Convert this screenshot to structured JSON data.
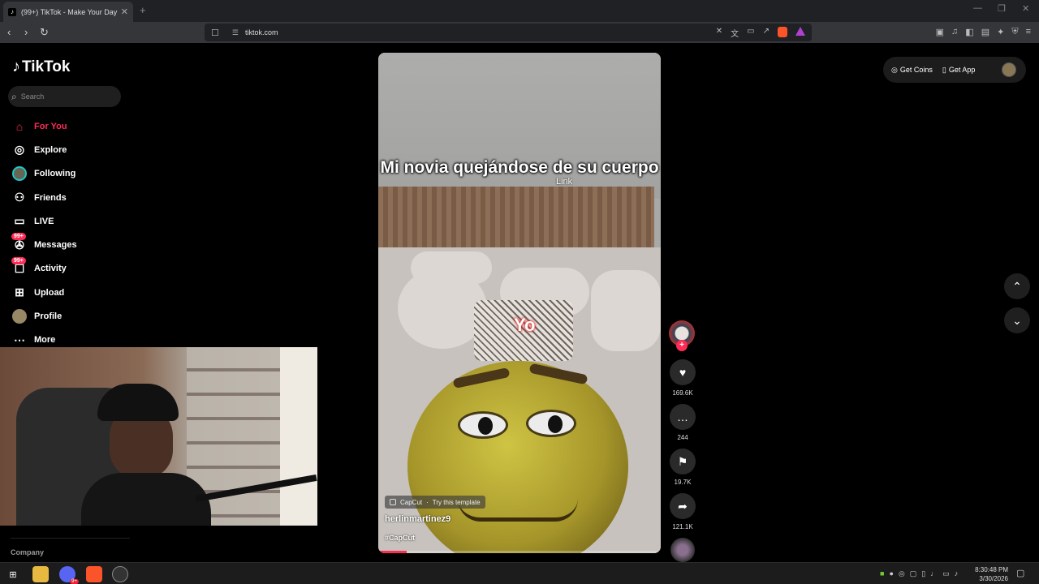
{
  "browser": {
    "tab_title": "(99+) TikTok - Make Your Day",
    "tab_favicon": "tiktok-note-icon",
    "new_tab": "+",
    "url": "tiktok.com",
    "window_controls": [
      "—",
      "❐",
      "✕"
    ]
  },
  "sidebar": {
    "logo_text": "TikTok",
    "search_placeholder": "Search",
    "items": [
      {
        "label": "For You",
        "icon": "home-icon",
        "active": true
      },
      {
        "label": "Explore",
        "icon": "compass-icon"
      },
      {
        "label": "Following",
        "icon": "following-avatar-icon"
      },
      {
        "label": "Friends",
        "icon": "friends-icon"
      },
      {
        "label": "LIVE",
        "icon": "live-tv-icon"
      },
      {
        "label": "Messages",
        "icon": "messages-icon",
        "badge": "99+"
      },
      {
        "label": "Activity",
        "icon": "activity-icon",
        "badge": "99+"
      },
      {
        "label": "Upload",
        "icon": "upload-icon"
      },
      {
        "label": "Profile",
        "icon": "profile-avatar-icon"
      },
      {
        "label": "More",
        "icon": "more-dots-icon"
      }
    ],
    "company_label": "Company"
  },
  "header": {
    "get_coins": "Get Coins",
    "get_app": "Get App"
  },
  "video": {
    "caption": "Mi novia quejándose de su cuerpo",
    "link_text": "Link",
    "overlay_label": "Yo",
    "capcut_brand": "CapCut",
    "capcut_cta": "Try this template",
    "author": "herlinmartinez9",
    "hashtag": "#CapCut",
    "progress": 0.1
  },
  "actions": {
    "likes": "169.6K",
    "comments": "244",
    "saves": "19.7K",
    "shares": "121.1K"
  },
  "taskbar": {
    "time": "8:30:48 PM",
    "date": "3/30/2026",
    "discord_badge": "9+"
  },
  "colors": {
    "accent": "#fe2c55",
    "background": "#000000",
    "chrome": "#35363a"
  }
}
